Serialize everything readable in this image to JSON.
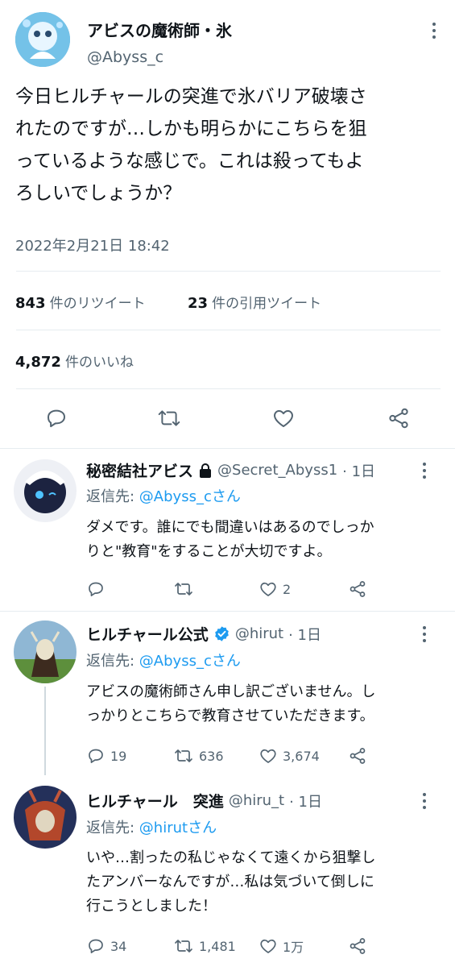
{
  "main_tweet": {
    "display_name": "アビスの魔術師・氷",
    "handle": "@Abyss_c",
    "text": "今日ヒルチャールの突進で氷バリア破壊されたのですが…しかも明らかにこちらを狙っているような感じで。これは殺ってもよろしいでしょうか？",
    "lines": [
      "今日ヒルチャールの突進で氷バリア破壊さ",
      "れたのですが…しかも明らかにこちらを狙",
      "っているような感じで。これは殺ってもよ",
      "ろしいでしょうか？"
    ],
    "timestamp": "2022年2月21日 18:42",
    "retweets": "843",
    "retweets_label": "件のリツイート",
    "quotes": "23",
    "quotes_label": "件の引用ツイート",
    "likes": "4,872",
    "likes_label": "件のいいね"
  },
  "replies": [
    {
      "display_name": "秘密結社アビス",
      "handle": "@Secret_Abyss1",
      "time": "· 1日",
      "reply_prefix": "返信先: ",
      "reply_to": "@Abyss_cさん",
      "lines": [
        "ダメです。誰にでも間違いはあるのでしっか",
        "りと\"教育\"をすることが大切ですよ。"
      ],
      "reply_count": "",
      "retweet_count": "",
      "like_count": "2"
    },
    {
      "display_name": "ヒルチャール公式",
      "handle": "@hirut",
      "time": "· 1日",
      "reply_prefix": "返信先: ",
      "reply_to": "@Abyss_cさん",
      "lines": [
        "アビスの魔術師さん申し訳ございません。し",
        "っかりとこちらで教育させていただきます。"
      ],
      "reply_count": "19",
      "retweet_count": "636",
      "like_count": "3,674"
    },
    {
      "display_name": "ヒルチャール　突進",
      "handle": "@hiru_t",
      "time": "· 1日",
      "reply_prefix": "返信先: ",
      "reply_to": "@hirutさん",
      "lines": [
        "いや…割ったの私じゃなくて遠くから狙撃し",
        "たアンバーなんですが…私は気づいて倒しに",
        "行こうとしました！"
      ],
      "reply_count": "34",
      "retweet_count": "1,481",
      "like_count": "1万"
    }
  ],
  "colors": {
    "link": "#1d9bf0",
    "verified": "#1d9bf0",
    "secondary": "#536471",
    "divider": "#e6ecf0"
  },
  "icons": [
    "more-icon",
    "reply-icon",
    "retweet-icon",
    "like-icon",
    "share-icon",
    "lock-icon",
    "verified-icon"
  ]
}
